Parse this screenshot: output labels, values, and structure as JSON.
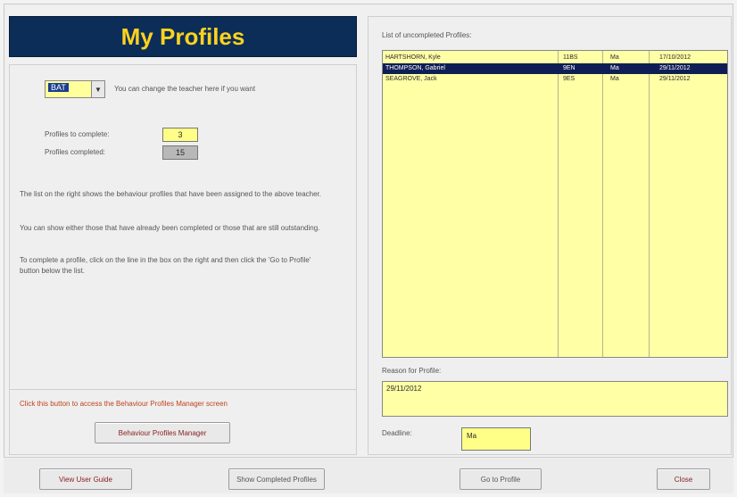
{
  "title": "My Profiles",
  "teacher": {
    "selected": "BAT",
    "hint": "You can change the teacher here if you want"
  },
  "stats": {
    "to_complete_label": "Profiles to complete:",
    "to_complete_value": "3",
    "completed_label": "Profiles completed:",
    "completed_value": "15"
  },
  "info": {
    "p1": "The list on the right shows the behaviour profiles that have been assigned to the above teacher.",
    "p2": "You can show either those that have already been completed or those that are still outstanding.",
    "p3": "To complete a profile, click on the line in the box on the right and then click the 'Go to Profile' button below the list."
  },
  "manager": {
    "hint": "Click this button to access the Behaviour Profiles Manager screen",
    "button": "Behaviour Profiles Manager"
  },
  "list": {
    "label": "List of uncompleted Profiles:",
    "rows": [
      {
        "name": "HARTSHORN, Kyle",
        "code": "11BS",
        "subject": "Ma",
        "date": "17/10/2012",
        "selected": false
      },
      {
        "name": "THOMPSON, Gabriel",
        "code": "9EN",
        "subject": "Ma",
        "date": "29/11/2012",
        "selected": true
      },
      {
        "name": "SEAGROVE, Jack",
        "code": "9ES",
        "subject": "Ma",
        "date": "29/11/2012",
        "selected": false
      }
    ]
  },
  "reason": {
    "label": "Reason for Profile:",
    "value": "29/11/2012"
  },
  "deadline": {
    "label": "Deadline:",
    "value": "Ma"
  },
  "bottom": {
    "user_guide": "View User Guide",
    "show_completed": "Show Completed Profiles",
    "go_to_profile": "Go to Profile",
    "close": "Close"
  },
  "colors": {
    "title_bg": "#0b2d57",
    "title_fg": "#ffd21f",
    "field_yellow": "#ffffa6",
    "selection": "#0f1f55",
    "hint_orange": "#c0421f"
  }
}
